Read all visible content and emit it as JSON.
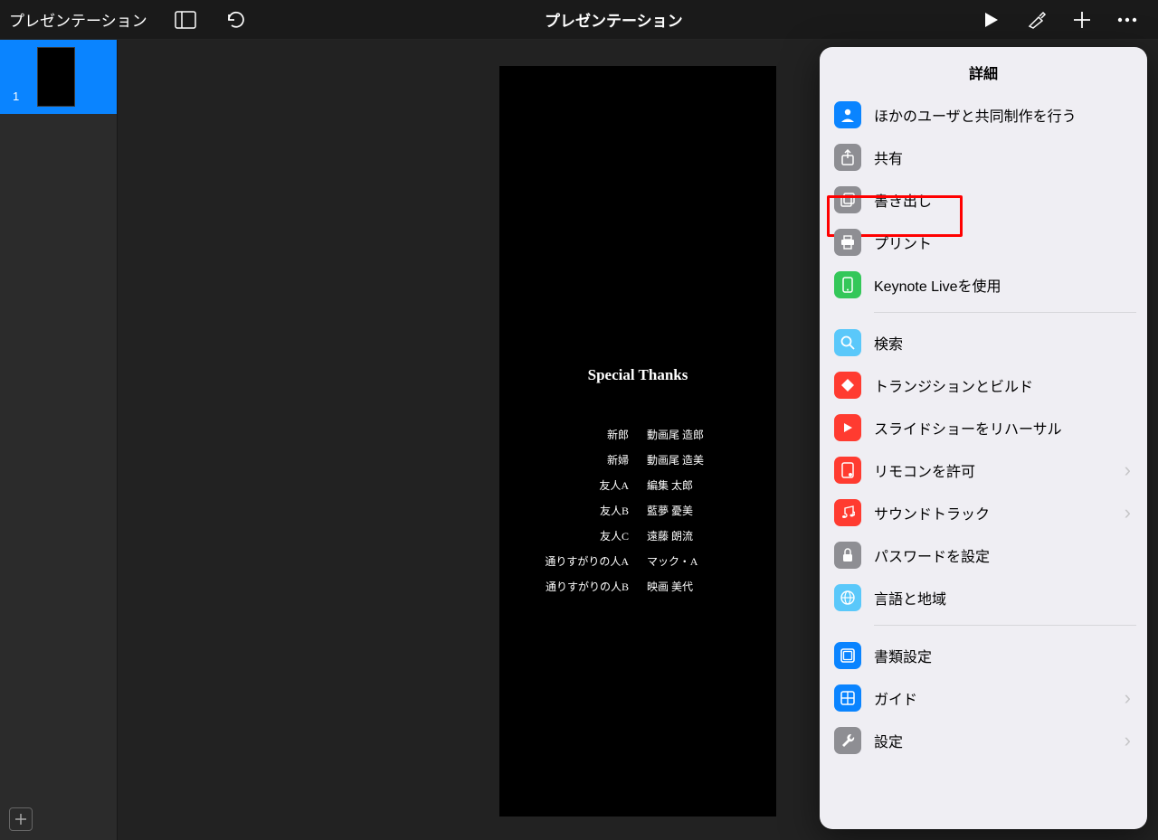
{
  "toolbar": {
    "back_label": "プレゼンテーション",
    "title": "プレゼンテーション"
  },
  "sidebar": {
    "slide_number": "1"
  },
  "slide": {
    "title": "Special Thanks",
    "credits": [
      {
        "role": "新郎",
        "name": "動画尾 造郎"
      },
      {
        "role": "新婦",
        "name": "動画尾 造美"
      },
      {
        "role": "友人A",
        "name": "編集 太郎"
      },
      {
        "role": "友人B",
        "name": "藍夢 憂美"
      },
      {
        "role": "友人C",
        "name": "遠藤 朗流"
      },
      {
        "role": "通りすがりの人A",
        "name": "マック・A"
      },
      {
        "role": "通りすがりの人B",
        "name": "映画 美代"
      }
    ]
  },
  "popover": {
    "title": "詳細",
    "items": {
      "collaborate": "ほかのユーザと共同制作を行う",
      "share": "共有",
      "export": "書き出し",
      "print": "プリント",
      "keynote_live": "Keynote Liveを使用",
      "search": "検索",
      "transitions": "トランジションとビルド",
      "rehearse": "スライドショーをリハーサル",
      "remote": "リモコンを許可",
      "soundtrack": "サウンドトラック",
      "password": "パスワードを設定",
      "lang_region": "言語と地域",
      "doc_setup": "書類設定",
      "guides": "ガイド",
      "settings": "設定"
    }
  }
}
